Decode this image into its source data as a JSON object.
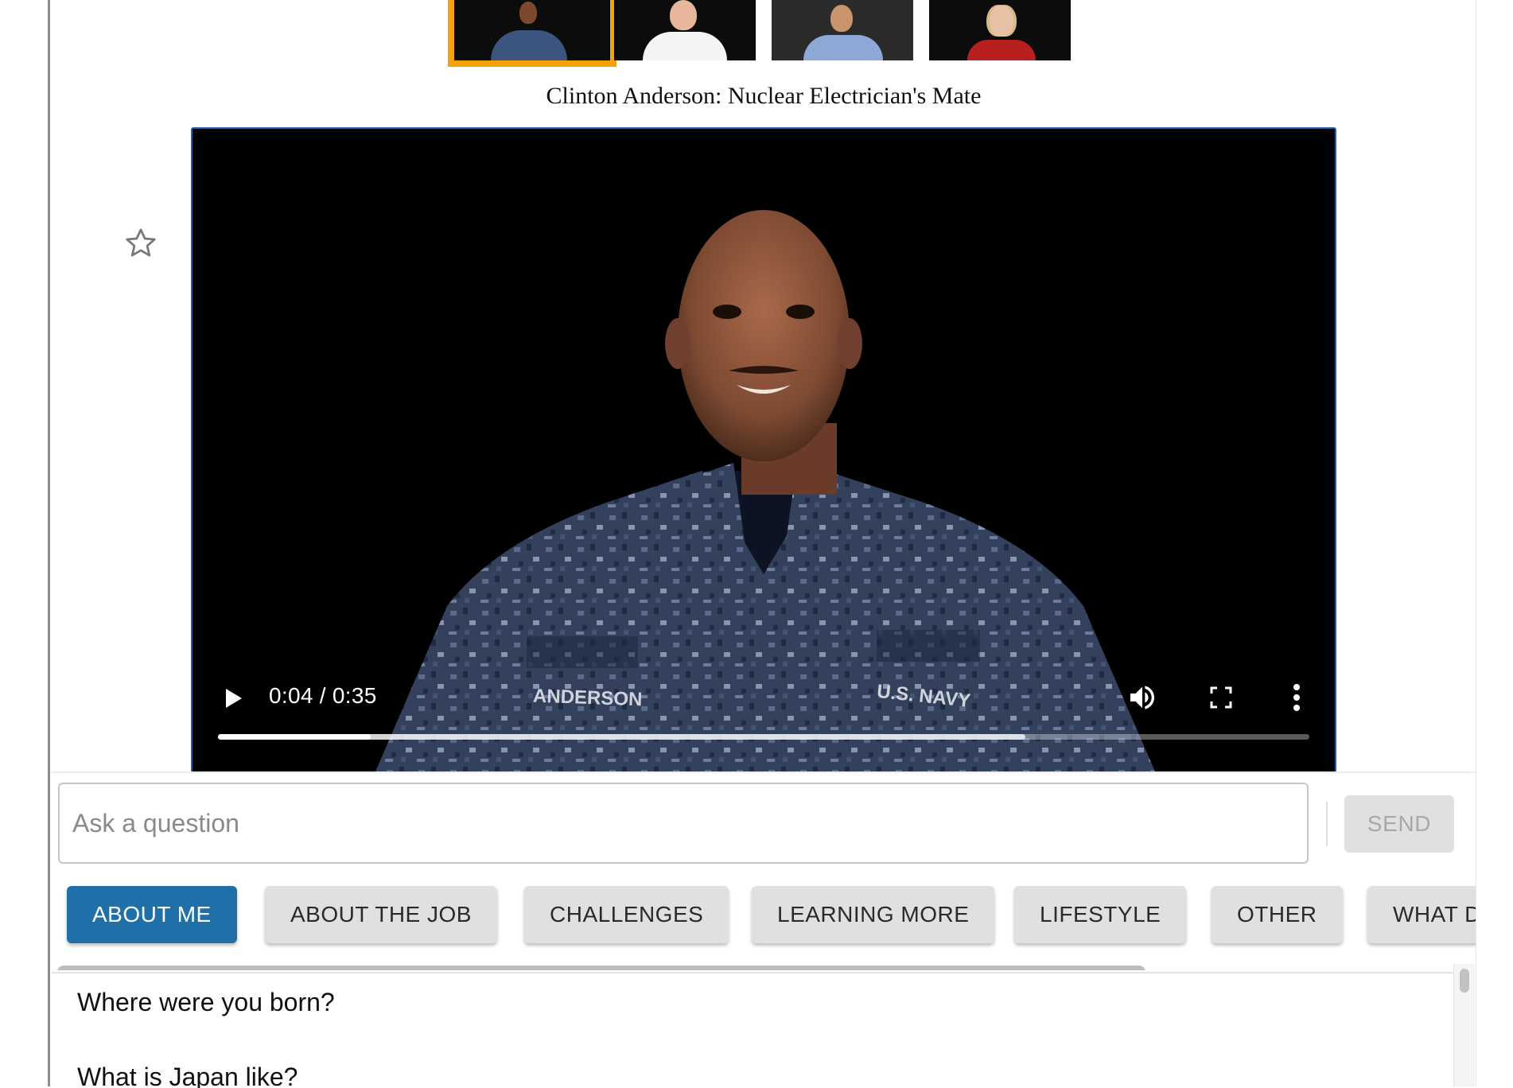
{
  "mentors": [
    {
      "name": "mentor-1",
      "selected": true,
      "shirt": "#2a3f6a",
      "skin": "#7b4a2e"
    },
    {
      "name": "mentor-2",
      "selected": false,
      "shirt": "#f4f4f4",
      "skin": "#e8b79b"
    },
    {
      "name": "mentor-3",
      "selected": false,
      "shirt": "#8fa9d6",
      "skin": "#c8956e"
    },
    {
      "name": "mentor-4",
      "selected": false,
      "shirt": "#b82020",
      "skin": "#e7c1a4"
    }
  ],
  "mentor_title": "Clinton Anderson: Nuclear Electrician's Mate",
  "video": {
    "time": "0:04 / 0:35",
    "progress": 0.14,
    "buffered": 0.74,
    "name_tape": "ANDERSON",
    "branch_tape": "U.S. NAVY"
  },
  "input": {
    "placeholder": "Ask a question",
    "value": ""
  },
  "send_label": "SEND",
  "topics": [
    "ABOUT ME",
    "ABOUT THE JOB",
    "CHALLENGES",
    "LEARNING MORE",
    "LIFESTYLE",
    "OTHER",
    "WHAT D"
  ],
  "active_topic": "ABOUT ME",
  "questions": [
    "Where were you born?",
    "What is Japan like?"
  ],
  "colors": {
    "accent": "#1f6fa8",
    "selected_border": "#f5a10a",
    "video_border": "#1a63b8"
  }
}
